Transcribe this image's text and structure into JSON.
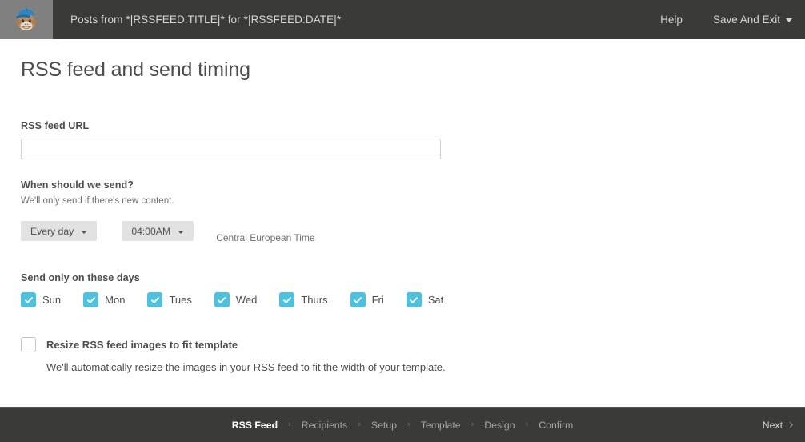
{
  "header": {
    "logo_icon": "mailchimp-freddie-logo",
    "campaign_title": "Posts from *|RSSFEED:TITLE|* for *|RSSFEED:DATE|*",
    "help_label": "Help",
    "save_exit_label": "Save And Exit",
    "save_exit_caret_icon": "chevron-down-icon",
    "background_color": "#3a3a38",
    "logo_background_color": "#808080"
  },
  "main": {
    "page_title": "RSS feed and send timing",
    "rss_url": {
      "label": "RSS feed URL",
      "value": "",
      "placeholder": ""
    },
    "when_to_send": {
      "label": "When should we send?",
      "note": "We'll only send if there's new content.",
      "frequency_select": {
        "value": "Every day",
        "caret_icon": "chevron-down-icon"
      },
      "time_select": {
        "value": "04:00AM",
        "caret_icon": "chevron-down-icon"
      },
      "timezone": "Central European Time"
    },
    "send_days": {
      "label": "Send only on these days",
      "accent_color": "#4cc2e0",
      "items": [
        {
          "label": "Sun",
          "checked": true
        },
        {
          "label": "Mon",
          "checked": true
        },
        {
          "label": "Tues",
          "checked": true
        },
        {
          "label": "Wed",
          "checked": true
        },
        {
          "label": "Thurs",
          "checked": true
        },
        {
          "label": "Fri",
          "checked": true
        },
        {
          "label": "Sat",
          "checked": true
        }
      ]
    },
    "resize_option": {
      "label": "Resize RSS feed images to fit template",
      "description": "We'll automatically resize the images in your RSS feed to fit the width of your template.",
      "checked": false
    }
  },
  "footer": {
    "steps": [
      {
        "label": "RSS Feed",
        "active": true
      },
      {
        "label": "Recipients",
        "active": false
      },
      {
        "label": "Setup",
        "active": false
      },
      {
        "label": "Template",
        "active": false
      },
      {
        "label": "Design",
        "active": false
      },
      {
        "label": "Confirm",
        "active": false
      }
    ],
    "separator": "›",
    "next_label": "Next",
    "next_icon": "chevron-right-icon",
    "background_color": "#3a3a38"
  }
}
